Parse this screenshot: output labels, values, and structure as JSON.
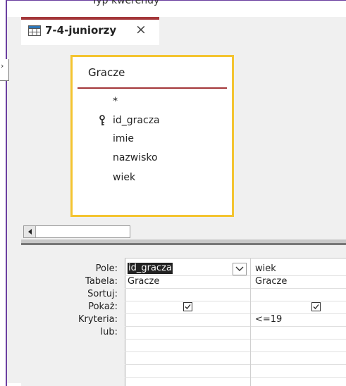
{
  "window": {
    "cut_title": "Typ kwerendy"
  },
  "tab": {
    "label": "7-4-juniorzy",
    "close": "×"
  },
  "left_panel": {
    "glyph": "›"
  },
  "table_box": {
    "title": "Gracze",
    "fields": [
      "*",
      "id_gracza",
      "imie",
      "nazwisko",
      "wiek"
    ],
    "primary_key": "id_gracza"
  },
  "qbe": {
    "row_labels": [
      "Pole:",
      "Tabela:",
      "Sortuj:",
      "Pokaż:",
      "Kryteria:",
      "lub:"
    ],
    "columns": [
      {
        "field": "id_gracza",
        "table": "Gracze",
        "sort": "",
        "show": true,
        "criteria": "",
        "or": ""
      },
      {
        "field": "wiek",
        "table": "Gracze",
        "sort": "",
        "show": true,
        "criteria": "<=19",
        "or": ""
      }
    ]
  },
  "colors": {
    "accent": "#a4373a",
    "frame": "#6b3fa0",
    "table_border": "#f4c430"
  }
}
